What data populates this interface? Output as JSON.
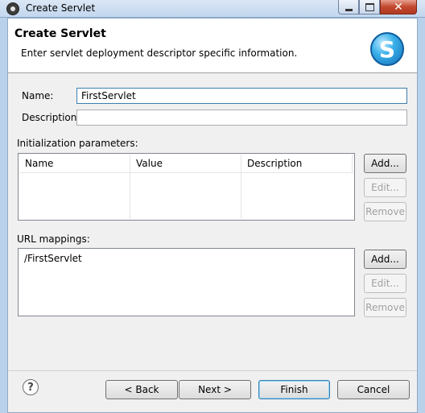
{
  "window": {
    "title": "Create Servlet",
    "close_glyph": "✕"
  },
  "banner": {
    "title": "Create Servlet",
    "description": "Enter servlet deployment descriptor specific information.",
    "logo_letter": "S"
  },
  "form": {
    "name_label": "Name:",
    "name_value": "FirstServlet",
    "description_label": "Description:",
    "description_value": ""
  },
  "init_params": {
    "label": "Initialization parameters:",
    "columns": [
      "Name",
      "Value",
      "Description"
    ],
    "buttons": {
      "add": "Add...",
      "edit": "Edit...",
      "remove": "Remove"
    }
  },
  "url_mappings": {
    "label": "URL mappings:",
    "items": [
      "/FirstServlet"
    ],
    "buttons": {
      "add": "Add...",
      "edit": "Edit...",
      "remove": "Remove"
    }
  },
  "footer": {
    "help_glyph": "?",
    "back": "< Back",
    "next": "Next >",
    "finish": "Finish",
    "cancel": "Cancel"
  }
}
